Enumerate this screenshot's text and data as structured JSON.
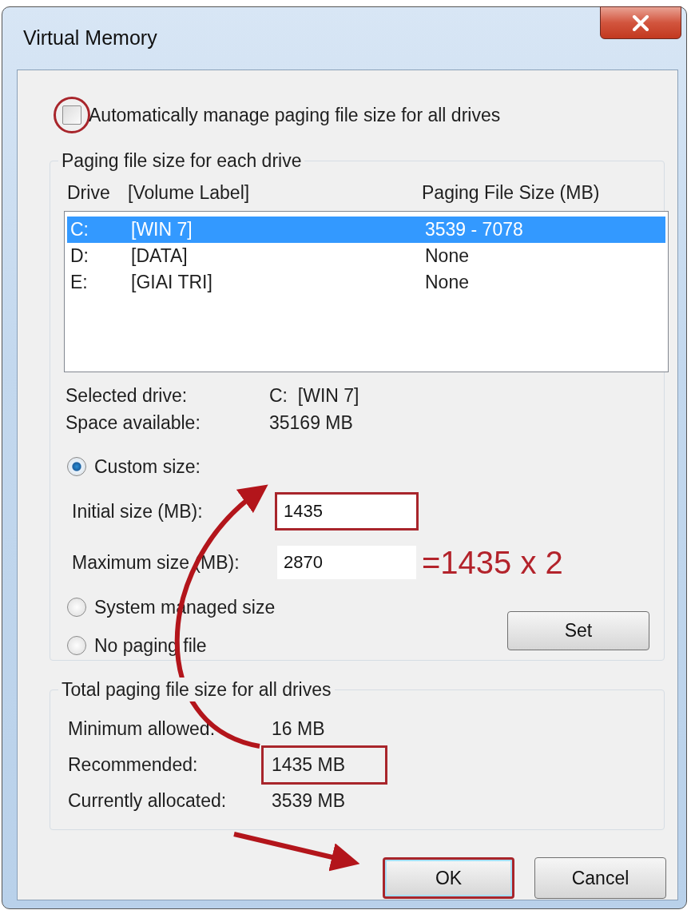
{
  "window": {
    "title": "Virtual Memory"
  },
  "auto_manage": {
    "label": "Automatically manage paging file size for all drives",
    "checked": false,
    "highlighted": true
  },
  "drive_group": {
    "title": "Paging file size for each drive",
    "columns": [
      "Drive",
      "[Volume Label]",
      "Paging File Size (MB)"
    ],
    "drives": [
      {
        "drive": "C:",
        "label": "[WIN 7]",
        "size": "3539 - 7078",
        "selected": true
      },
      {
        "drive": "D:",
        "label": "[DATA]",
        "size": "None",
        "selected": false
      },
      {
        "drive": "E:",
        "label": "[GIAI TRI]",
        "size": "None",
        "selected": false
      }
    ],
    "info": [
      {
        "label": "Selected drive:",
        "value": "C:  [WIN 7]"
      },
      {
        "label": "Space available:",
        "value": "35169 MB"
      }
    ],
    "options": [
      {
        "label": "Custom size:",
        "selected": true
      },
      {
        "label": "System managed size",
        "selected": false
      },
      {
        "label": "No paging file",
        "selected": false
      }
    ],
    "fields": [
      {
        "label": "Initial size (MB):",
        "value": "1435",
        "highlighted": true
      },
      {
        "label": "Maximum size (MB):",
        "value": "2870",
        "highlighted": false,
        "note": "=1435 x 2"
      }
    ],
    "set_button": "Set"
  },
  "total_group": {
    "title": "Total paging file size for all drives",
    "rows": [
      {
        "label": "Minimum allowed:",
        "value": "16 MB",
        "highlighted": false
      },
      {
        "label": "Recommended:",
        "value": "1435 MB",
        "highlighted": true
      },
      {
        "label": "Currently allocated:",
        "value": "3539 MB",
        "highlighted": false
      }
    ]
  },
  "buttons": [
    {
      "label": "OK",
      "highlighted": true
    },
    {
      "label": "Cancel",
      "highlighted": false
    }
  ]
}
